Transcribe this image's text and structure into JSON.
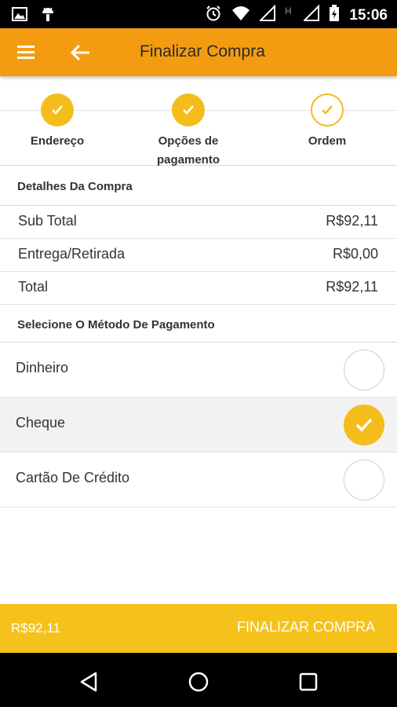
{
  "status_bar": {
    "time": "15:06",
    "icons": [
      "image-icon",
      "android-icon",
      "alarm-icon",
      "wifi-icon",
      "signal-icon",
      "h-network-icon",
      "signal-icon-2",
      "battery-icon"
    ]
  },
  "app_bar": {
    "title": "Finalizar Compra",
    "menu_icon": "hamburger-menu-icon",
    "back_icon": "arrow-back-icon",
    "color": "#f39c12"
  },
  "steps": [
    {
      "label": "Endereço",
      "state": "done"
    },
    {
      "label": "Opções de pagamento",
      "state": "done"
    },
    {
      "label": "Ordem",
      "state": "current"
    }
  ],
  "details": {
    "header": "Detalhes Da Compra",
    "rows": [
      {
        "label": "Sub Total",
        "value": "R$92,11"
      },
      {
        "label": "Entrega/Retirada",
        "value": "R$0,00"
      },
      {
        "label": "Total",
        "value": "R$92,11"
      }
    ]
  },
  "payment": {
    "header": "Selecione O Método De Pagamento",
    "options": [
      {
        "label": "Dinheiro",
        "selected": false
      },
      {
        "label": "Cheque",
        "selected": true
      },
      {
        "label": "Cartão De Crédito",
        "selected": false
      }
    ]
  },
  "bottom_bar": {
    "total": "R$92,11",
    "action": "FINALIZAR COMPRA",
    "color": "#f5c21b"
  },
  "nav_bar": {
    "icons": [
      "back-triangle-icon",
      "home-circle-icon",
      "recents-square-icon"
    ]
  },
  "accent": "#f5bd1c"
}
